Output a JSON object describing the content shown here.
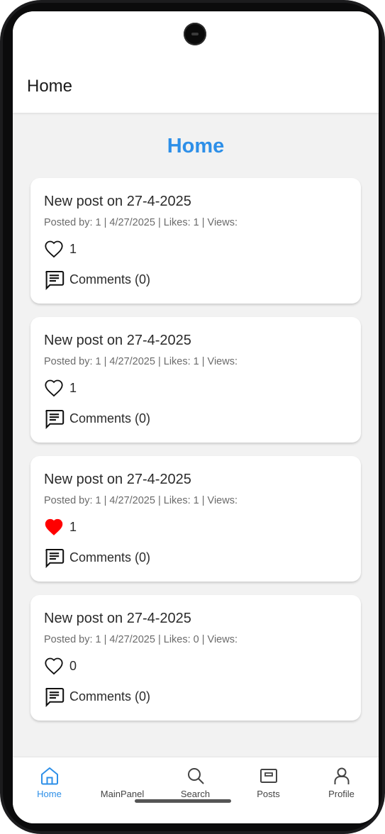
{
  "appbar": {
    "title": "Home"
  },
  "page": {
    "heading": "Home"
  },
  "posts": [
    {
      "title": "New post on 27-4-2025",
      "meta": "Posted by: 1 | 4/27/2025 | Likes: 1 | Views:",
      "like_count": "1",
      "liked": false,
      "comments_label": "Comments (0)"
    },
    {
      "title": "New post on 27-4-2025",
      "meta": "Posted by: 1 | 4/27/2025 | Likes: 1 | Views:",
      "like_count": "1",
      "liked": false,
      "comments_label": "Comments (0)"
    },
    {
      "title": "New post on 27-4-2025",
      "meta": "Posted by: 1 | 4/27/2025 | Likes: 1 | Views:",
      "like_count": "1",
      "liked": true,
      "comments_label": "Comments (0)"
    },
    {
      "title": "New post on 27-4-2025",
      "meta": "Posted by: 1 | 4/27/2025 | Likes: 0 | Views:",
      "like_count": "0",
      "liked": false,
      "comments_label": "Comments (0)"
    }
  ],
  "bottom_nav": {
    "items": [
      {
        "label": "Home",
        "icon": "home-icon",
        "active": true
      },
      {
        "label": "MainPanel",
        "icon": "none",
        "active": false
      },
      {
        "label": "Search",
        "icon": "search-icon",
        "active": false
      },
      {
        "label": "Posts",
        "icon": "posts-icon",
        "active": false
      },
      {
        "label": "Profile",
        "icon": "profile-icon",
        "active": false
      }
    ]
  },
  "colors": {
    "accent": "#2d8fe8",
    "liked_heart": "#ff0000",
    "background": "#f2f2f2"
  }
}
